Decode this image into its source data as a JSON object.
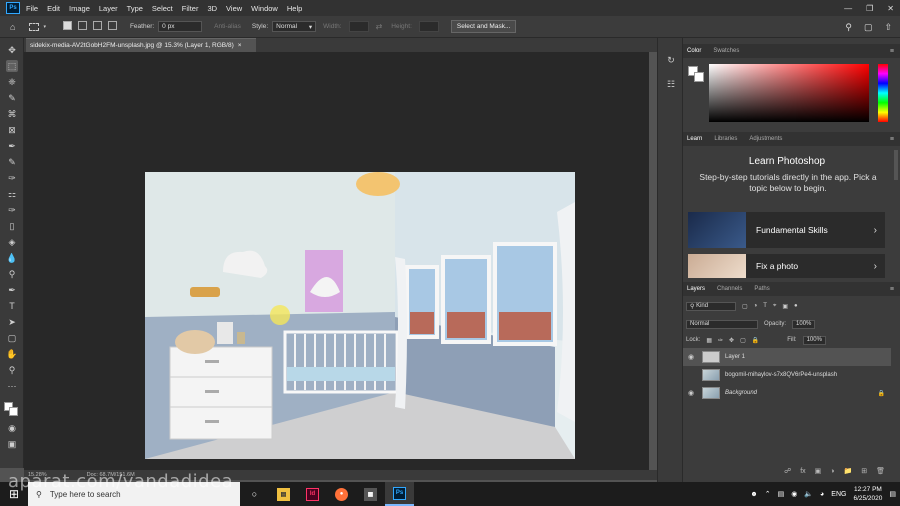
{
  "menu": [
    "File",
    "Edit",
    "Image",
    "Layer",
    "Type",
    "Select",
    "Filter",
    "3D",
    "View",
    "Window",
    "Help"
  ],
  "app_logo": "Ps",
  "options": {
    "feather_label": "Feather:",
    "feather_value": "0 px",
    "antialias_label": "Anti-alias",
    "style_label": "Style:",
    "style_value": "Normal",
    "width_label": "Width:",
    "height_label": "Height:",
    "select_mask_button": "Select and Mask..."
  },
  "document": {
    "tab_title": "sidekix-media-AV2tGobH2FM-unsplash.jpg @ 15.3% (Layer 1, RGB/8)",
    "tab_close": "×",
    "zoom": "15.28%",
    "doc_size": "Doc: 68.7M/151.6M"
  },
  "panels": {
    "color_tabs": [
      "Color",
      "Swatches"
    ],
    "learn_tabs": [
      "Learn",
      "Libraries",
      "Adjustments"
    ],
    "learn_title": "Learn Photoshop",
    "learn_desc": "Step-by-step tutorials directly in the app. Pick a topic below to begin.",
    "learn_cards": [
      {
        "title": "Fundamental Skills"
      },
      {
        "title": "Fix a photo"
      }
    ],
    "layer_tabs": [
      "Layers",
      "Channels",
      "Paths"
    ],
    "kind_label": "Kind",
    "blend_mode": "Normal",
    "opacity_label": "Opacity:",
    "opacity_value": "100%",
    "lock_label": "Lock:",
    "fill_label": "Fill:",
    "fill_value": "100%",
    "layers": [
      {
        "name": "Layer 1",
        "visible": true,
        "selected": true
      },
      {
        "name": "bogomil-mihaylov-s7x8QV6rPe4-unsplash",
        "visible": false,
        "selected": false
      },
      {
        "name": "Background",
        "visible": true,
        "selected": false,
        "locked": true
      }
    ]
  },
  "taskbar": {
    "search_placeholder": "Type here to search",
    "apps": [
      "task-view",
      "explorer",
      "indesign",
      "firefox",
      "calculator",
      "photoshop"
    ],
    "language": "ENG",
    "time": "12:27 PM",
    "date": "6/25/2020"
  },
  "watermark": "aparat.com/vandadidea"
}
